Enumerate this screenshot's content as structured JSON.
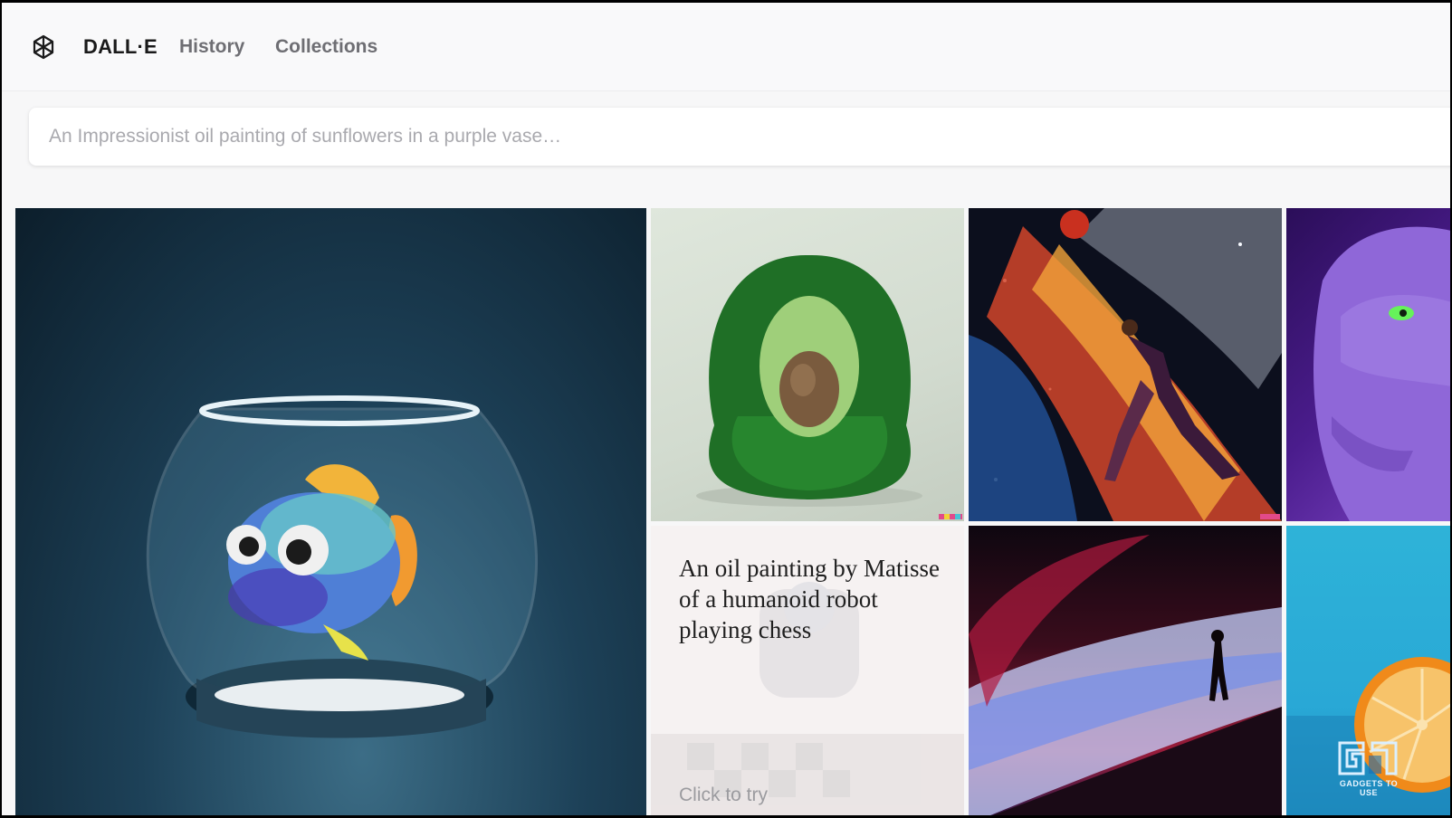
{
  "header": {
    "brand": "DALL·E",
    "nav": [
      "History",
      "Collections"
    ]
  },
  "prompt": {
    "placeholder": "An Impressionist oil painting of sunflowers in a purple vase…",
    "value": ""
  },
  "gallery": {
    "example_prompt": "An oil painting by Matisse of a humanoid robot playing chess",
    "example_cta": "Click to try"
  },
  "watermark": {
    "caption": "GADGETS TO USE"
  },
  "colors": {
    "page_bg": "#f7f7f8",
    "text_primary": "#1a1a1a",
    "nav_text": "#6e6e73",
    "placeholder": "#a9a9ae"
  },
  "icons": {
    "logo": "openai-logo-icon"
  }
}
